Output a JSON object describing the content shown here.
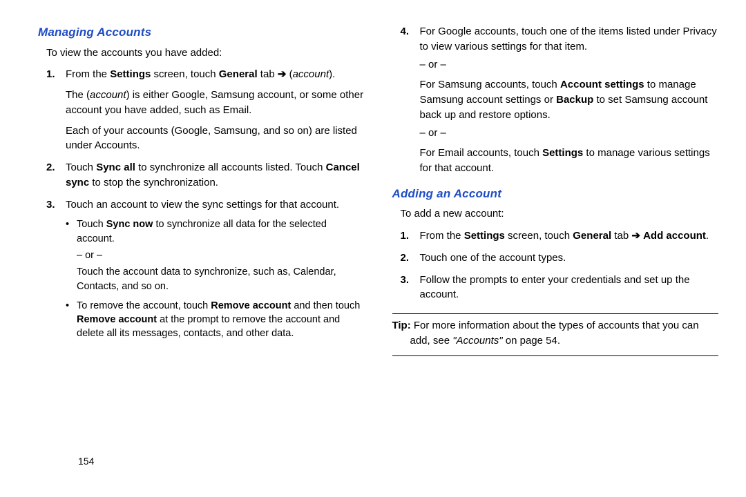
{
  "page_number": "154",
  "left": {
    "heading": "Managing Accounts",
    "intro": "To view the accounts you have added:",
    "s1_a": "From the ",
    "s1_b": "Settings",
    "s1_c": " screen, touch ",
    "s1_d": "General",
    "s1_e": " tab ",
    "s1_arrow": "➔",
    "s1_f": "(",
    "s1_g": "account",
    "s1_h": ").",
    "s1_p2a": "The (",
    "s1_p2b": "account",
    "s1_p2c": ") is either Google, Samsung account, or some other account you have added, such as Email.",
    "s1_p3": "Each of your accounts (Google, Samsung, and so on) are listed under Accounts.",
    "s2_a": "Touch ",
    "s2_b": "Sync all",
    "s2_c": " to synchronize all accounts listed. Touch ",
    "s2_d": "Cancel sync",
    "s2_e": " to stop the synchronization.",
    "s3_a": "Touch an account to view the sync settings for that account.",
    "b1_a": "Touch ",
    "b1_b": "Sync now",
    "b1_c": " to synchronize all data for the selected account.",
    "or": "– or –",
    "b1_d": "Touch the account data to synchronize, such as, Calendar, Contacts, and so on.",
    "b2_a": "To remove the account, touch ",
    "b2_b": "Remove account",
    "b2_c": " and then touch ",
    "b2_d": "Remove account",
    "b2_e": " at the prompt to remove the account and delete all its messages, contacts, and other data."
  },
  "right": {
    "s4_a": "For Google accounts, touch one of the items listed under Privacy to view various settings for that item.",
    "or": "– or –",
    "s4_b1": "For Samsung accounts, touch ",
    "s4_b2": "Account settings",
    "s4_b3": " to manage Samsung account settings or ",
    "s4_b4": "Backup",
    "s4_b5": " to set Samsung account back up and restore options.",
    "s4_c1": "For Email accounts, touch ",
    "s4_c2": "Settings",
    "s4_c3": " to manage various settings for that account.",
    "heading": "Adding an Account",
    "intro": "To add a new account:",
    "a1_a": "From the ",
    "a1_b": "Settings",
    "a1_c": " screen, touch ",
    "a1_d": "General",
    "a1_e": " tab ",
    "a1_arrow": "➔",
    "a1_f": "Add account",
    "a1_g": ".",
    "a2": "Touch one of the account types.",
    "a3": "Follow the prompts to enter your credentials and set up the account.",
    "tip_a": "Tip:",
    "tip_b": " For more information about the types of accounts that you can add, see ",
    "tip_c": "\"Accounts\"",
    "tip_d": " on page 54."
  }
}
